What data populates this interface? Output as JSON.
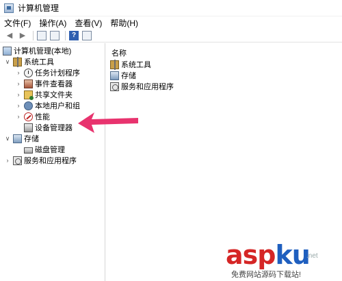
{
  "window": {
    "title": "计算机管理"
  },
  "menu": [
    "文件(F)",
    "操作(A)",
    "查看(V)",
    "帮助(H)"
  ],
  "toolbar": {
    "help_label": "?"
  },
  "tree": {
    "root": "计算机管理(本地)",
    "system_tools": "系统工具",
    "task_scheduler": "任务计划程序",
    "event_viewer": "事件查看器",
    "shared_folders": "共享文件夹",
    "local_users": "本地用户和组",
    "performance": "性能",
    "device_manager": "设备管理器",
    "storage": "存储",
    "disk_management": "磁盘管理",
    "services_apps": "服务和应用程序"
  },
  "list": {
    "column_name": "名称",
    "items": [
      "系统工具",
      "存储",
      "服务和应用程序"
    ]
  },
  "watermark": {
    "main": "asp",
    "accent": "ku",
    "net": ".net",
    "sub": "免费网站源码下载站!"
  },
  "colors": {
    "arrow": "#e8336e",
    "watermark_red": "#d52626",
    "watermark_blue": "#1f5fbf"
  }
}
